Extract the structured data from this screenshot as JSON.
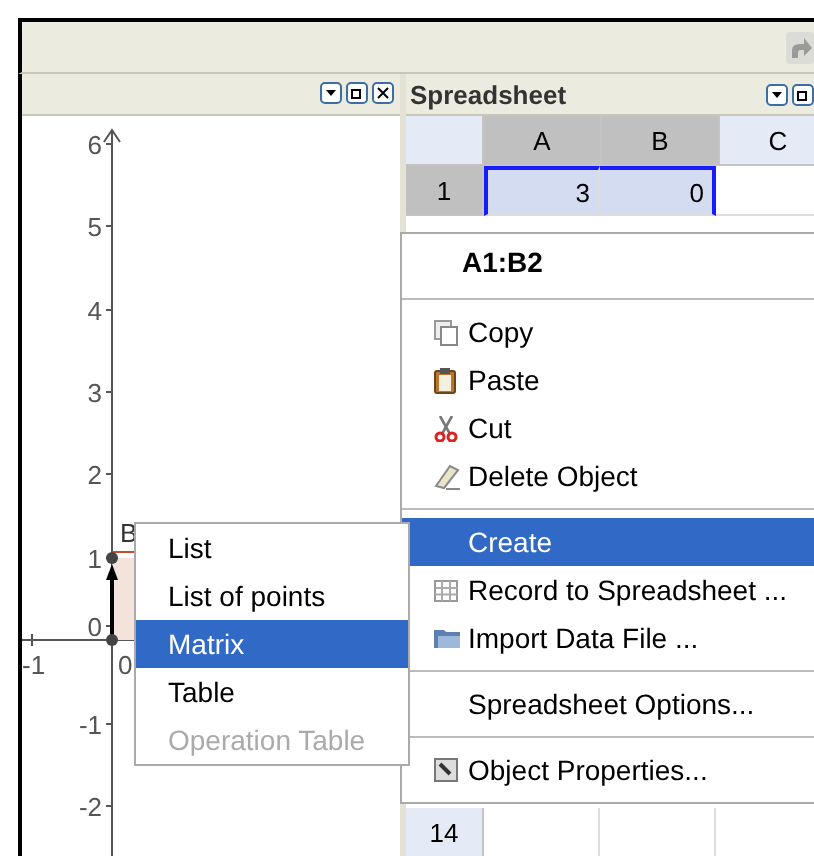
{
  "graphics_view": {
    "y_ticks": [
      "6",
      "5",
      "4",
      "3",
      "2",
      "1",
      "0",
      "-1",
      "-2"
    ],
    "x_ticks": [
      "-1",
      "0"
    ],
    "point_label": "B"
  },
  "spreadsheet": {
    "title": "Spreadsheet",
    "columns": [
      {
        "label": "A",
        "selected": true
      },
      {
        "label": "B",
        "selected": true
      },
      {
        "label": "C",
        "selected": false
      }
    ],
    "rows": [
      {
        "header": "1",
        "cells": [
          {
            "value": "3",
            "selected": true
          },
          {
            "value": "0",
            "selected": true
          },
          {
            "selected": false
          }
        ]
      }
    ],
    "last_row": "14"
  },
  "context_menu": {
    "title": "A1:B2",
    "groups": [
      [
        {
          "label": "Copy",
          "selected": false
        },
        {
          "label": "Paste",
          "selected": false
        },
        {
          "label": "Cut",
          "selected": false
        },
        {
          "label": "Delete Object",
          "selected": false
        }
      ],
      [
        {
          "label": "Create",
          "selected": true
        },
        {
          "label": "Record to Spreadsheet ...",
          "selected": false
        },
        {
          "label": "Import Data File ...",
          "selected": false
        }
      ],
      [
        {
          "label": "Spreadsheet Options...",
          "selected": false
        }
      ],
      [
        {
          "label": "Object Properties...",
          "selected": false
        }
      ]
    ]
  },
  "submenu": {
    "items": [
      {
        "label": "List",
        "selected": false,
        "disabled": false
      },
      {
        "label": "List of points",
        "selected": false,
        "disabled": false
      },
      {
        "label": "Matrix",
        "selected": true,
        "disabled": false
      },
      {
        "label": "Table",
        "selected": false,
        "disabled": false
      },
      {
        "label": "Operation Table",
        "selected": false,
        "disabled": true
      }
    ]
  }
}
